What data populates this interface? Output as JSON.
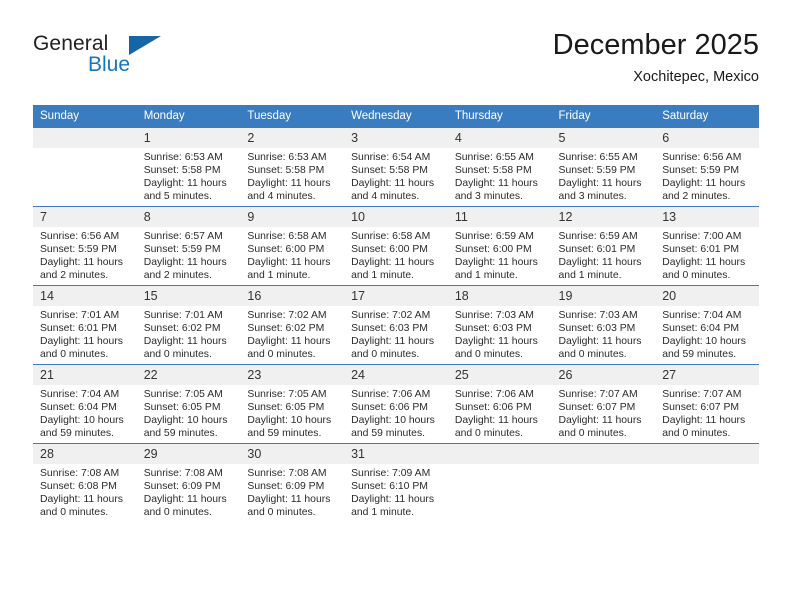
{
  "logo": {
    "word_one": "General",
    "word_two": "Blue",
    "accent_color": "#1876bc",
    "triangle_color": "#1565a8",
    "triangle_icon": "triangle-icon"
  },
  "header": {
    "title": "December 2025",
    "subtitle": "Xochitepec, Mexico"
  },
  "calendar": {
    "header_bg": "#3a7cc0",
    "daynum_bg": "#f0f0f0",
    "weekday_headers": [
      "Sunday",
      "Monday",
      "Tuesday",
      "Wednesday",
      "Thursday",
      "Friday",
      "Saturday"
    ],
    "weeks": [
      [
        {
          "day": "",
          "sunrise": "",
          "sunset": "",
          "daylight": "",
          "daylight2": ""
        },
        {
          "day": "1",
          "sunrise": "Sunrise: 6:53 AM",
          "sunset": "Sunset: 5:58 PM",
          "daylight": "Daylight: 11 hours",
          "daylight2": "and 5 minutes."
        },
        {
          "day": "2",
          "sunrise": "Sunrise: 6:53 AM",
          "sunset": "Sunset: 5:58 PM",
          "daylight": "Daylight: 11 hours",
          "daylight2": "and 4 minutes."
        },
        {
          "day": "3",
          "sunrise": "Sunrise: 6:54 AM",
          "sunset": "Sunset: 5:58 PM",
          "daylight": "Daylight: 11 hours",
          "daylight2": "and 4 minutes."
        },
        {
          "day": "4",
          "sunrise": "Sunrise: 6:55 AM",
          "sunset": "Sunset: 5:58 PM",
          "daylight": "Daylight: 11 hours",
          "daylight2": "and 3 minutes."
        },
        {
          "day": "5",
          "sunrise": "Sunrise: 6:55 AM",
          "sunset": "Sunset: 5:59 PM",
          "daylight": "Daylight: 11 hours",
          "daylight2": "and 3 minutes."
        },
        {
          "day": "6",
          "sunrise": "Sunrise: 6:56 AM",
          "sunset": "Sunset: 5:59 PM",
          "daylight": "Daylight: 11 hours",
          "daylight2": "and 2 minutes."
        }
      ],
      [
        {
          "day": "7",
          "sunrise": "Sunrise: 6:56 AM",
          "sunset": "Sunset: 5:59 PM",
          "daylight": "Daylight: 11 hours",
          "daylight2": "and 2 minutes."
        },
        {
          "day": "8",
          "sunrise": "Sunrise: 6:57 AM",
          "sunset": "Sunset: 5:59 PM",
          "daylight": "Daylight: 11 hours",
          "daylight2": "and 2 minutes."
        },
        {
          "day": "9",
          "sunrise": "Sunrise: 6:58 AM",
          "sunset": "Sunset: 6:00 PM",
          "daylight": "Daylight: 11 hours",
          "daylight2": "and 1 minute."
        },
        {
          "day": "10",
          "sunrise": "Sunrise: 6:58 AM",
          "sunset": "Sunset: 6:00 PM",
          "daylight": "Daylight: 11 hours",
          "daylight2": "and 1 minute."
        },
        {
          "day": "11",
          "sunrise": "Sunrise: 6:59 AM",
          "sunset": "Sunset: 6:00 PM",
          "daylight": "Daylight: 11 hours",
          "daylight2": "and 1 minute."
        },
        {
          "day": "12",
          "sunrise": "Sunrise: 6:59 AM",
          "sunset": "Sunset: 6:01 PM",
          "daylight": "Daylight: 11 hours",
          "daylight2": "and 1 minute."
        },
        {
          "day": "13",
          "sunrise": "Sunrise: 7:00 AM",
          "sunset": "Sunset: 6:01 PM",
          "daylight": "Daylight: 11 hours",
          "daylight2": "and 0 minutes."
        }
      ],
      [
        {
          "day": "14",
          "sunrise": "Sunrise: 7:01 AM",
          "sunset": "Sunset: 6:01 PM",
          "daylight": "Daylight: 11 hours",
          "daylight2": "and 0 minutes."
        },
        {
          "day": "15",
          "sunrise": "Sunrise: 7:01 AM",
          "sunset": "Sunset: 6:02 PM",
          "daylight": "Daylight: 11 hours",
          "daylight2": "and 0 minutes."
        },
        {
          "day": "16",
          "sunrise": "Sunrise: 7:02 AM",
          "sunset": "Sunset: 6:02 PM",
          "daylight": "Daylight: 11 hours",
          "daylight2": "and 0 minutes."
        },
        {
          "day": "17",
          "sunrise": "Sunrise: 7:02 AM",
          "sunset": "Sunset: 6:03 PM",
          "daylight": "Daylight: 11 hours",
          "daylight2": "and 0 minutes."
        },
        {
          "day": "18",
          "sunrise": "Sunrise: 7:03 AM",
          "sunset": "Sunset: 6:03 PM",
          "daylight": "Daylight: 11 hours",
          "daylight2": "and 0 minutes."
        },
        {
          "day": "19",
          "sunrise": "Sunrise: 7:03 AM",
          "sunset": "Sunset: 6:03 PM",
          "daylight": "Daylight: 11 hours",
          "daylight2": "and 0 minutes."
        },
        {
          "day": "20",
          "sunrise": "Sunrise: 7:04 AM",
          "sunset": "Sunset: 6:04 PM",
          "daylight": "Daylight: 10 hours",
          "daylight2": "and 59 minutes."
        }
      ],
      [
        {
          "day": "21",
          "sunrise": "Sunrise: 7:04 AM",
          "sunset": "Sunset: 6:04 PM",
          "daylight": "Daylight: 10 hours",
          "daylight2": "and 59 minutes."
        },
        {
          "day": "22",
          "sunrise": "Sunrise: 7:05 AM",
          "sunset": "Sunset: 6:05 PM",
          "daylight": "Daylight: 10 hours",
          "daylight2": "and 59 minutes."
        },
        {
          "day": "23",
          "sunrise": "Sunrise: 7:05 AM",
          "sunset": "Sunset: 6:05 PM",
          "daylight": "Daylight: 10 hours",
          "daylight2": "and 59 minutes."
        },
        {
          "day": "24",
          "sunrise": "Sunrise: 7:06 AM",
          "sunset": "Sunset: 6:06 PM",
          "daylight": "Daylight: 10 hours",
          "daylight2": "and 59 minutes."
        },
        {
          "day": "25",
          "sunrise": "Sunrise: 7:06 AM",
          "sunset": "Sunset: 6:06 PM",
          "daylight": "Daylight: 11 hours",
          "daylight2": "and 0 minutes."
        },
        {
          "day": "26",
          "sunrise": "Sunrise: 7:07 AM",
          "sunset": "Sunset: 6:07 PM",
          "daylight": "Daylight: 11 hours",
          "daylight2": "and 0 minutes."
        },
        {
          "day": "27",
          "sunrise": "Sunrise: 7:07 AM",
          "sunset": "Sunset: 6:07 PM",
          "daylight": "Daylight: 11 hours",
          "daylight2": "and 0 minutes."
        }
      ],
      [
        {
          "day": "28",
          "sunrise": "Sunrise: 7:08 AM",
          "sunset": "Sunset: 6:08 PM",
          "daylight": "Daylight: 11 hours",
          "daylight2": "and 0 minutes."
        },
        {
          "day": "29",
          "sunrise": "Sunrise: 7:08 AM",
          "sunset": "Sunset: 6:09 PM",
          "daylight": "Daylight: 11 hours",
          "daylight2": "and 0 minutes."
        },
        {
          "day": "30",
          "sunrise": "Sunrise: 7:08 AM",
          "sunset": "Sunset: 6:09 PM",
          "daylight": "Daylight: 11 hours",
          "daylight2": "and 0 minutes."
        },
        {
          "day": "31",
          "sunrise": "Sunrise: 7:09 AM",
          "sunset": "Sunset: 6:10 PM",
          "daylight": "Daylight: 11 hours",
          "daylight2": "and 1 minute."
        },
        {
          "day": "",
          "sunrise": "",
          "sunset": "",
          "daylight": "",
          "daylight2": ""
        },
        {
          "day": "",
          "sunrise": "",
          "sunset": "",
          "daylight": "",
          "daylight2": ""
        },
        {
          "day": "",
          "sunrise": "",
          "sunset": "",
          "daylight": "",
          "daylight2": ""
        }
      ]
    ]
  }
}
